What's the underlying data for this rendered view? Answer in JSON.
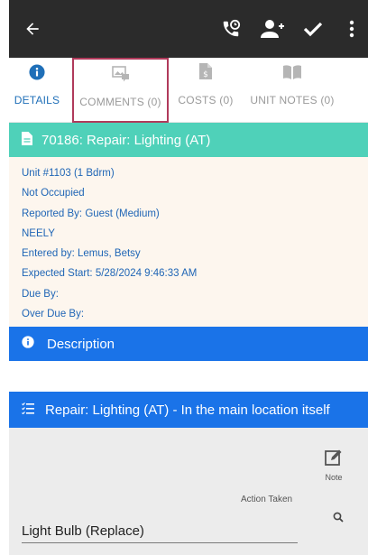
{
  "appbar": {
    "back_icon": "arrow-left-icon",
    "phone_icon": "phone-clock-icon",
    "add_user_icon": "person-add-icon",
    "check_icon": "check-icon",
    "more_icon": "more-vertical-icon",
    "bg_color": "#2b2b2b"
  },
  "tabs": [
    {
      "label": "DETAILS",
      "icon": "info-circle-icon",
      "active": true
    },
    {
      "label": "COMMENTS (0)",
      "icon": "image-comment-icon",
      "active": false
    },
    {
      "label": "COSTS (0)",
      "icon": "cost-document-icon",
      "active": false
    },
    {
      "label": "UNIT NOTES (0)",
      "icon": "book-icon",
      "active": false
    }
  ],
  "work_order": {
    "title": "70186: Repair: Lighting (AT)",
    "header_color": "#4fd1b9"
  },
  "details": {
    "unit": "Unit #1103 (1 Bdrm)",
    "occupancy": "Not Occupied",
    "reported_by": "Reported By: Guest  (Medium)",
    "name": "NEELY",
    "entered_by": "Entered by: Lemus, Betsy",
    "expected_start": "Expected Start: 5/28/2024 9:46:33 AM",
    "due_by": "Due By:",
    "over_due_by": "Over Due By:"
  },
  "description": {
    "label": "Description",
    "bar_color": "#1a73e8"
  },
  "task": {
    "label": "Repair: Lighting (AT) - In the main location itself"
  },
  "action": {
    "note_label": "Note",
    "action_taken_label": "Action Taken",
    "value": "Light Bulb (Replace)"
  }
}
